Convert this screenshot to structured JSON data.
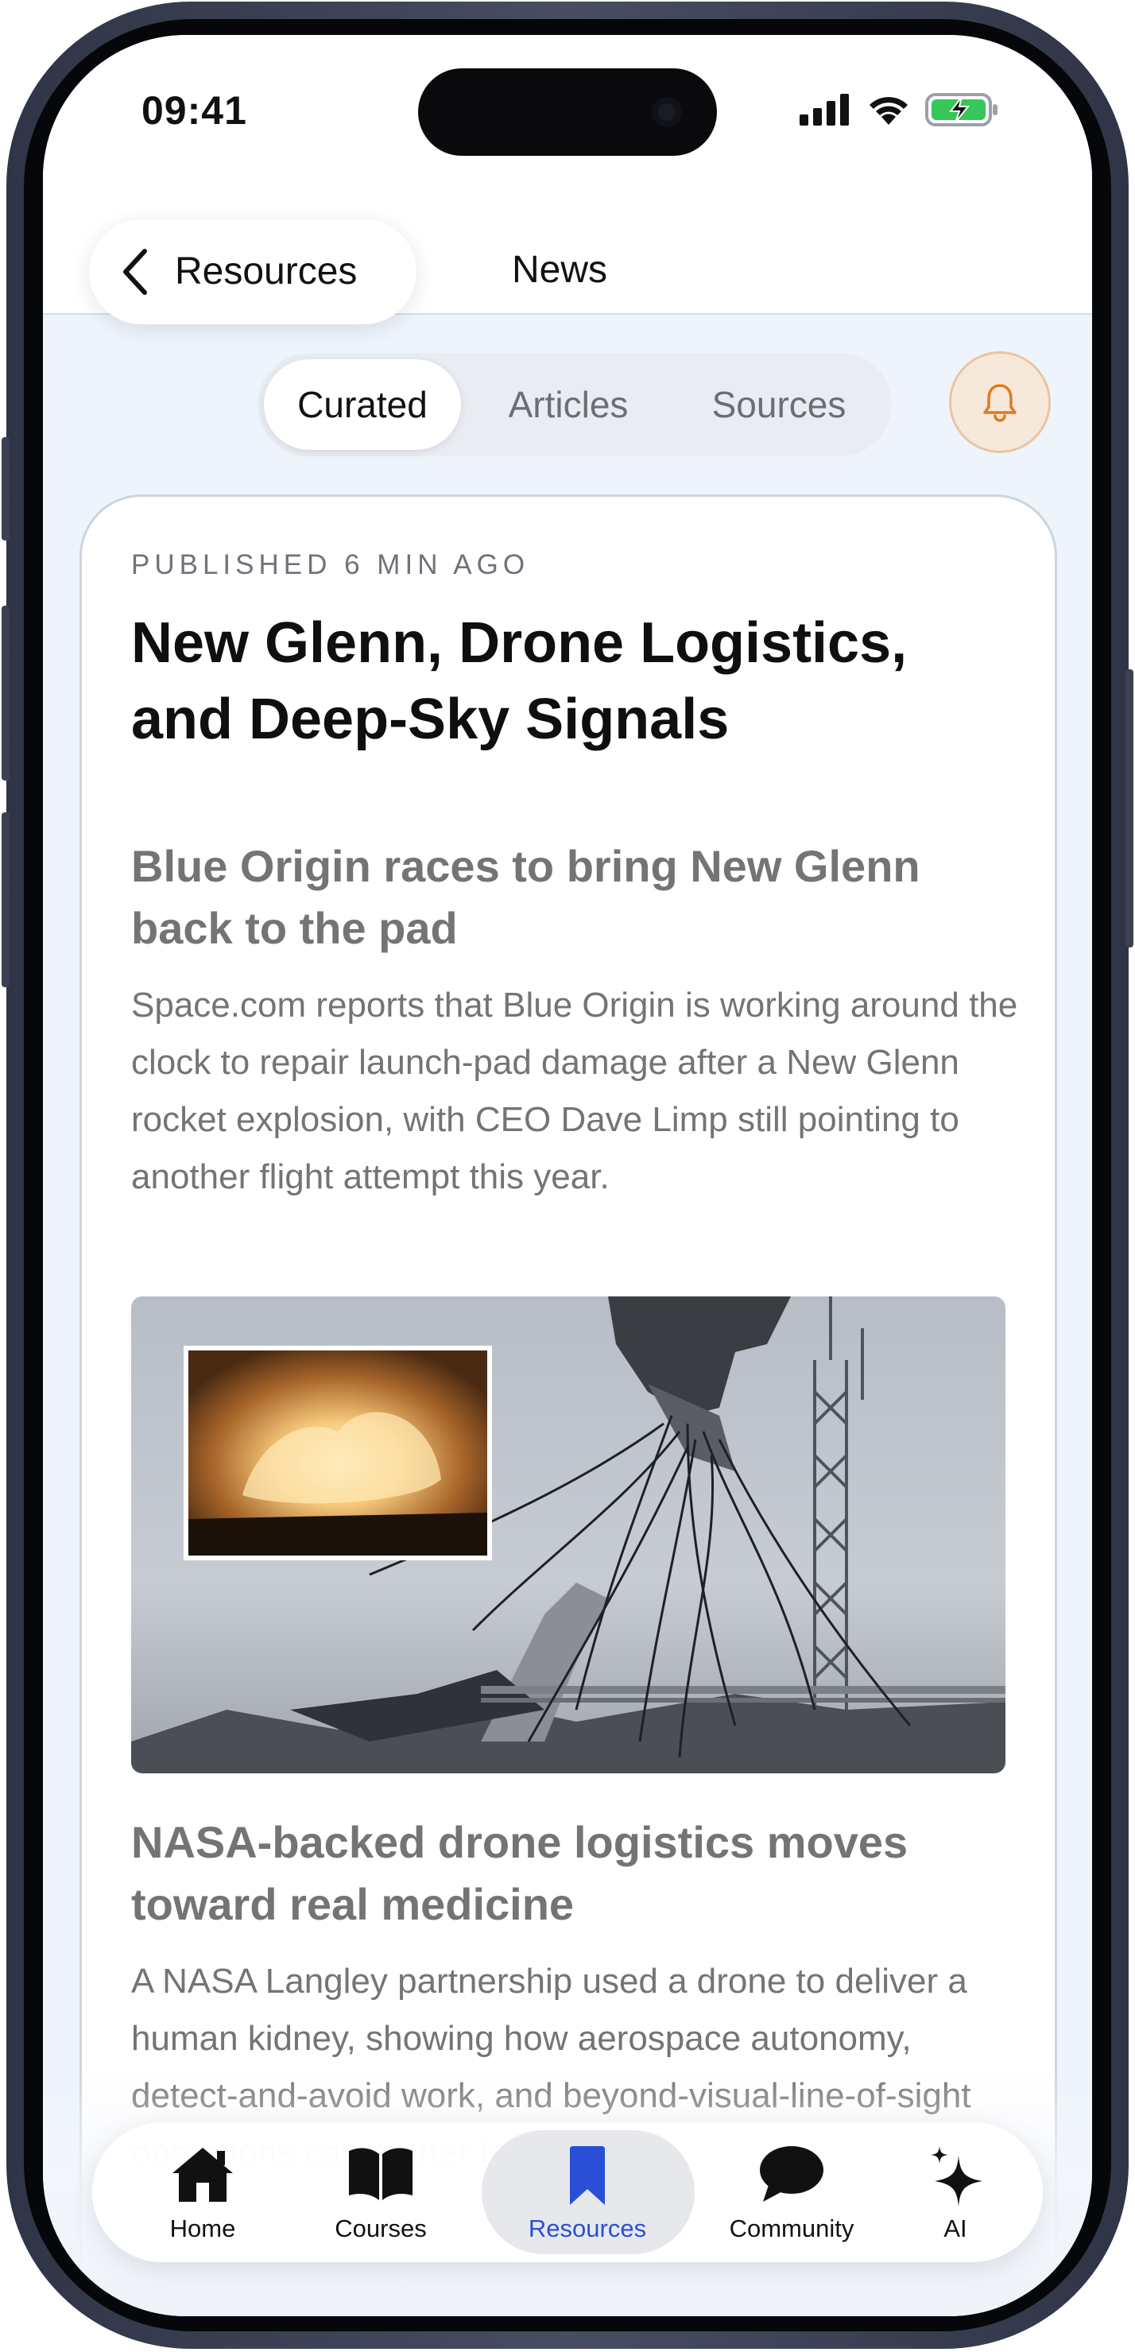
{
  "status_bar": {
    "time": "09:41"
  },
  "nav": {
    "back_label": "Resources",
    "title": "News"
  },
  "segments": [
    {
      "label": "Curated",
      "active": true
    },
    {
      "label": "Articles",
      "active": false
    },
    {
      "label": "Sources",
      "active": false
    }
  ],
  "digest": {
    "published": "PUBLISHED 6 MIN AGO",
    "title": "New Glenn, Drone Logistics, and Deep-Sky Signals",
    "items": [
      {
        "headline": "Blue Origin races to bring New Glenn back to the pad",
        "summary": "Space.com reports that Blue Origin is working around the clock to repair launch-pad damage after a New Glenn rocket explosion, with CEO Dave Limp still pointing to another flight attempt this year."
      },
      {
        "headline": "NASA-backed drone logistics moves toward real medicine",
        "summary": "A NASA Langley partnership used a drone to deliver a human kidney, showing how aerospace autonomy, detect-and-avoid work, and beyond-visual-line-of-sight operations can matter for"
      }
    ]
  },
  "tab_bar": {
    "items": [
      {
        "label": "Home",
        "icon": "home-icon"
      },
      {
        "label": "Courses",
        "icon": "book-icon"
      },
      {
        "label": "Resources",
        "icon": "bookmark-icon",
        "active": true
      },
      {
        "label": "Community",
        "icon": "chat-bubble-icon"
      },
      {
        "label": "AI",
        "icon": "sparkles-icon"
      }
    ]
  },
  "colors": {
    "accent": "#2a4fd6",
    "bell_accent": "#e07a1f",
    "muted_text": "#747474"
  }
}
